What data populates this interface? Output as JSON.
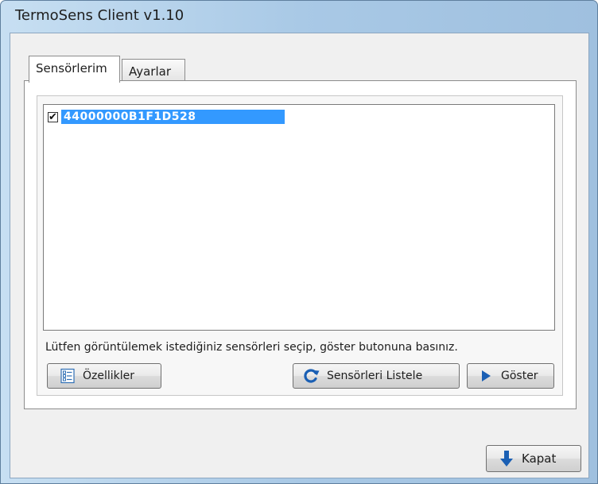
{
  "window": {
    "title": "TermoSens Client v1.10"
  },
  "tabs": [
    {
      "label": "Sensörlerim",
      "active": true
    },
    {
      "label": "Ayarlar",
      "active": false
    }
  ],
  "sensors": {
    "items": [
      {
        "id": "44000000B1F1D528",
        "checked": true,
        "selected": true,
        "check_glyph": "✔"
      }
    ],
    "hint": "Lütfen görüntülemek istediğiniz sensörleri seçip, göster butonuna basınız."
  },
  "buttons": {
    "properties": {
      "label": "Özellikler",
      "icon": "properties-icon"
    },
    "list_sensors": {
      "label": "Sensörleri Listele",
      "icon": "refresh-icon"
    },
    "show": {
      "label": "Göster",
      "icon": "play-icon"
    },
    "close": {
      "label": "Kapat",
      "icon": "down-arrow-icon"
    }
  },
  "colors": {
    "selection": "#3399ff",
    "accent_blue": "#1a5fb4"
  }
}
